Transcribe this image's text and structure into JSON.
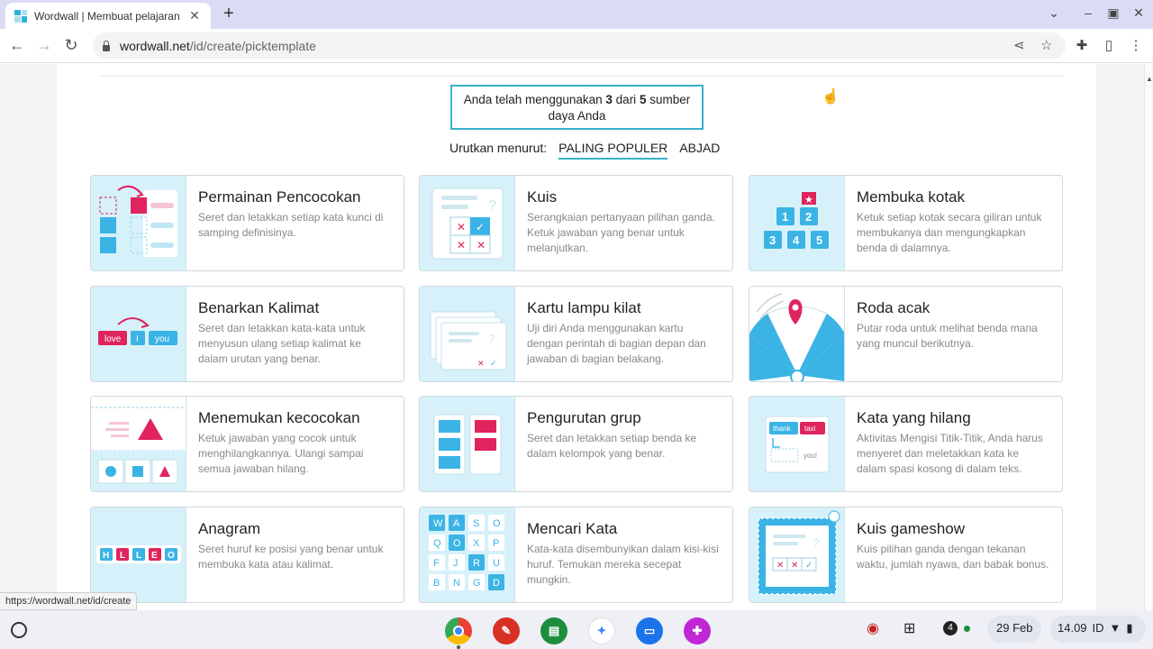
{
  "browser": {
    "tab_title": "Wordwall | Membuat pelajaran",
    "url_host": "wordwall.net",
    "url_path": "/id/create/picktemplate",
    "status_url": "https://wordwall.net/id/create"
  },
  "quota": {
    "prefix": "Anda telah menggunakan",
    "used": "3",
    "mid": "dari",
    "total": "5",
    "suffix": "sumber daya Anda"
  },
  "sort": {
    "label": "Urutkan menurut:",
    "options": [
      "PALING POPULER",
      "ABJAD"
    ],
    "active": "PALING POPULER"
  },
  "templates": [
    {
      "name": "Permainan Pencocokan",
      "desc": "Seret dan letakkan setiap kata kunci di samping definisinya."
    },
    {
      "name": "Kuis",
      "desc": "Serangkaian pertanyaan pilihan ganda. Ketuk jawaban yang benar untuk melanjutkan."
    },
    {
      "name": "Membuka kotak",
      "desc": "Ketuk setiap kotak secara giliran untuk membukanya dan mengungkapkan benda di dalamnya."
    },
    {
      "name": "Benarkan Kalimat",
      "desc": "Seret dan letakkan kata-kata untuk menyusun ulang setiap kalimat ke dalam urutan yang benar."
    },
    {
      "name": "Kartu lampu kilat",
      "desc": "Uji diri Anda menggunakan kartu dengan perintah di bagian depan dan jawaban di bagian belakang."
    },
    {
      "name": "Roda acak",
      "desc": "Putar roda untuk melihat benda mana yang muncul berikutnya."
    },
    {
      "name": "Menemukan kecocokan",
      "desc": "Ketuk jawaban yang cocok untuk menghilangkannya. Ulangi sampai semua jawaban hilang."
    },
    {
      "name": "Pengurutan grup",
      "desc": "Seret dan letakkan setiap benda ke dalam kelompok yang benar."
    },
    {
      "name": "Kata yang hilang",
      "desc": "Aktivitas Mengisi Titik-Titik, Anda harus menyeret dan meletakkan kata ke dalam spasi kosong di dalam teks."
    },
    {
      "name": "Anagram",
      "desc": "Seret huruf ke posisi yang benar untuk membuka kata atau kalimat."
    },
    {
      "name": "Mencari Kata",
      "desc": "Kata-kata disembunyikan dalam kisi-kisi huruf. Temukan mereka secepat mungkin."
    },
    {
      "name": "Kuis gameshow",
      "desc": "Kuis pilihan ganda dengan tekanan waktu, jumlah nyawa, dan babak bonus."
    }
  ],
  "thumb_text": {
    "unbox_numbers": [
      "1",
      "2",
      "3",
      "4",
      "5"
    ],
    "sentence_words": [
      "love",
      "I",
      "you"
    ],
    "missing_words": [
      "thank",
      "taxi",
      "you!"
    ],
    "anagram_letters": [
      "H",
      "L",
      "L",
      "E",
      "O"
    ],
    "wordsearch_letters": [
      "W",
      "A",
      "S",
      "O",
      "Q",
      "O",
      "X",
      "P",
      "F",
      "J",
      "R",
      "U",
      "B",
      "N",
      "G",
      "D"
    ]
  },
  "shelf": {
    "notification_count": "4",
    "date": "29 Feb",
    "time": "14.09",
    "locale": "ID"
  },
  "colors": {
    "accent": "#3ab0c8",
    "thumb_bg": "#d7f1fa",
    "pink": "#e0245e",
    "blue": "#3bb4e5"
  }
}
